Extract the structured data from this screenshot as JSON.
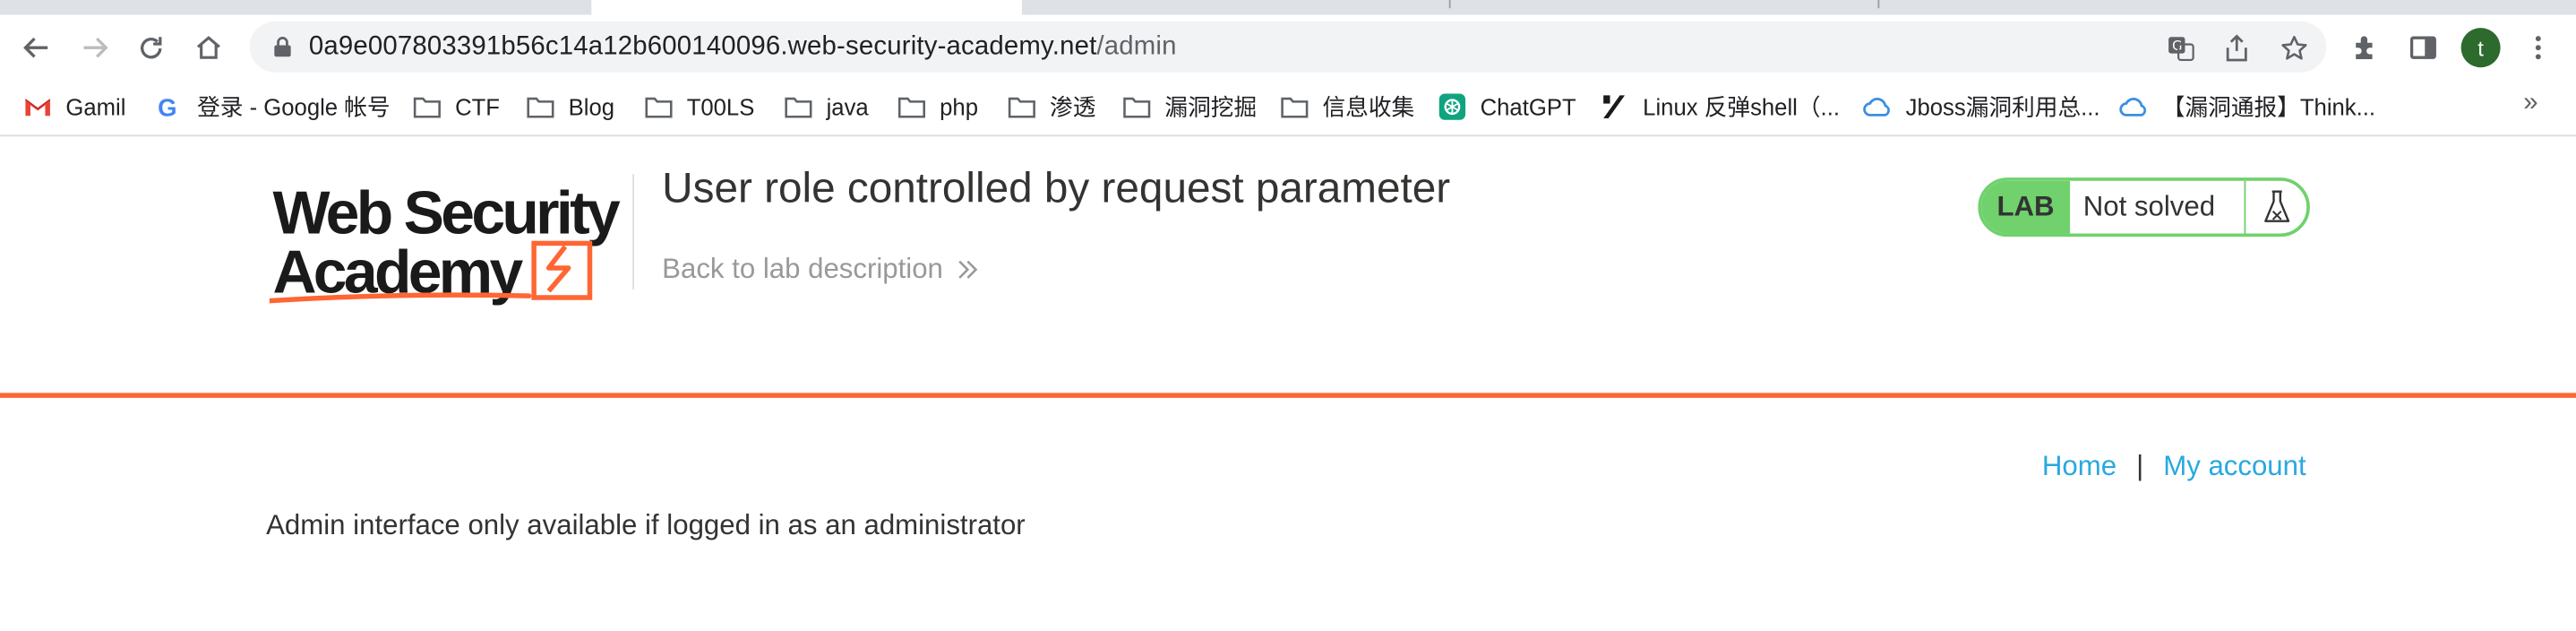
{
  "browser": {
    "url_host": "0a9e007803391b56c14a12b600140096.web-security-academy.net",
    "url_path": "/admin",
    "profile_initial": "t",
    "bookmarks": [
      {
        "label": "Gamil",
        "icon": "gmail-icon"
      },
      {
        "label": "登录 - Google 帐号",
        "icon": "google-icon"
      },
      {
        "label": "CTF",
        "icon": "folder-icon"
      },
      {
        "label": "Blog",
        "icon": "folder-icon"
      },
      {
        "label": "T00LS",
        "icon": "folder-icon"
      },
      {
        "label": "java",
        "icon": "folder-icon"
      },
      {
        "label": "php",
        "icon": "folder-icon"
      },
      {
        "label": "渗透",
        "icon": "folder-icon"
      },
      {
        "label": "漏洞挖掘",
        "icon": "folder-icon"
      },
      {
        "label": "信息收集",
        "icon": "folder-icon"
      },
      {
        "label": "ChatGPT",
        "icon": "chatgpt-icon"
      },
      {
        "label": "Linux 反弹shell（...",
        "icon": "slash-logo-icon"
      },
      {
        "label": "Jboss漏洞利用总...",
        "icon": "cloud-icon"
      },
      {
        "label": "【漏洞通报】Think...",
        "icon": "cloud-icon"
      }
    ],
    "more_label": "»"
  },
  "header": {
    "logo_line1": "Web Security",
    "logo_line2": "Academy",
    "lab_title": "User role controlled by request parameter",
    "back_link": "Back to lab description"
  },
  "lab_status": {
    "badge": "LAB",
    "state": "Not solved",
    "badge_color": "#70d16d"
  },
  "nav": {
    "home": "Home",
    "separator": "|",
    "my_account": "My account"
  },
  "content": {
    "message": "Admin interface only available if logged in as an administrator"
  },
  "colors": {
    "accent_orange": "#ff6633",
    "link_blue": "#29a8e0"
  }
}
